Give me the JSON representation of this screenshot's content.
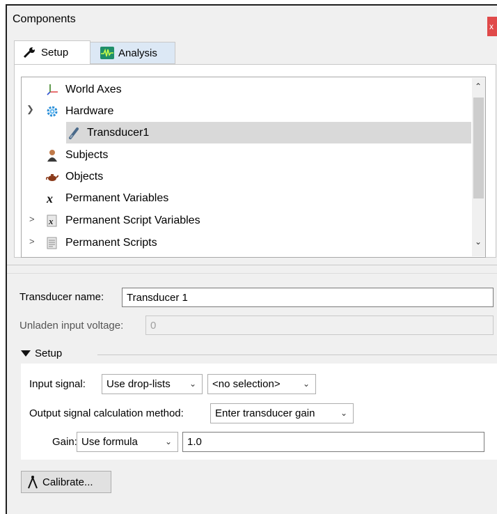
{
  "window": {
    "title": "Components",
    "close_label": "x"
  },
  "tabs": [
    {
      "label": "Setup",
      "icon": "wrench-icon",
      "active": true
    },
    {
      "label": "Analysis",
      "icon": "waveform-icon",
      "active": false
    }
  ],
  "tree": {
    "items": [
      {
        "label": "World Axes",
        "icon": "axes-icon",
        "expander": ""
      },
      {
        "label": "Hardware",
        "icon": "gear-icon",
        "expander": "expanded"
      },
      {
        "label": "Transducer1",
        "icon": "transducer-icon",
        "expander": "",
        "selected": true
      },
      {
        "label": "Subjects",
        "icon": "person-icon",
        "expander": ""
      },
      {
        "label": "Objects",
        "icon": "teapot-icon",
        "expander": ""
      },
      {
        "label": "Permanent Variables",
        "icon": "variable-x-icon",
        "expander": ""
      },
      {
        "label": "Permanent Script Variables",
        "icon": "script-variable-icon",
        "expander": "collapsed"
      },
      {
        "label": "Permanent Scripts",
        "icon": "script-icon",
        "expander": "collapsed"
      }
    ]
  },
  "properties": {
    "transducer_name_label": "Transducer name:",
    "transducer_name_value": "Transducer 1",
    "unladen_label": "Unladen input voltage:",
    "unladen_value": "0",
    "setup_group_label": "Setup",
    "input_signal_label": "Input signal:",
    "input_signal_mode": "Use drop-lists",
    "input_signal_selection": "<no selection>",
    "output_method_label": "Output signal calculation method:",
    "output_method_value": "Enter transducer gain",
    "gain_label": "Gain:",
    "gain_mode": "Use formula",
    "gain_value": "1.0",
    "calibrate_label": "Calibrate..."
  },
  "colors": {
    "selection": "#d9d9d9",
    "active_tab": "#ffffff",
    "inactive_tab": "#dce8f5",
    "close": "#e04a4a"
  }
}
